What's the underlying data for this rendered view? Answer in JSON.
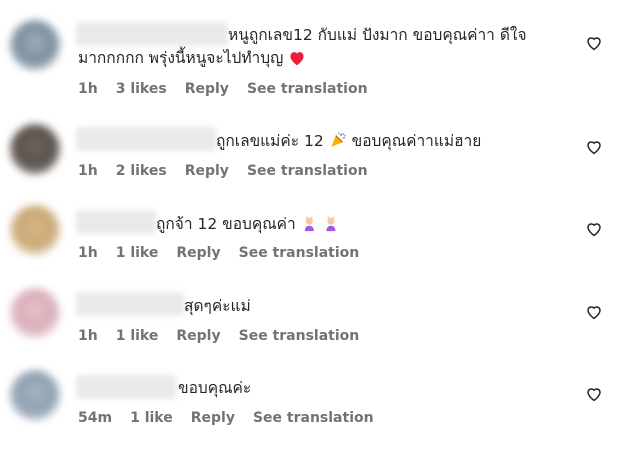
{
  "colors": {
    "text": "#262626",
    "meta": "#737373",
    "heart_red": "#ff3040"
  },
  "comments": [
    {
      "line1": "หนูถูกเลข12 กับแม่ ปังมาก ขอบคุณค่าา ดีใจ",
      "line2": "มากกกกก พรุ่งนี้หนูจะไปทำบุญ",
      "emoji": "red-heart",
      "time": "1h",
      "likes": "3 likes",
      "reply": "Reply",
      "translation": "See translation"
    },
    {
      "line1": "ถูกเลขแม่ค่ะ 12",
      "line1_suffix": "ขอบคุณค่าาแม่ฮาย",
      "emoji": "party-popper",
      "time": "1h",
      "likes": "2 likes",
      "reply": "Reply",
      "translation": "See translation"
    },
    {
      "line1": "ถูกจ้า 12 ขอบคุณค่า",
      "emoji": "people-with-bunny-ears",
      "time": "1h",
      "likes": "1 like",
      "reply": "Reply",
      "translation": "See translation"
    },
    {
      "line1": "สุดๆค่ะแม่",
      "time": "1h",
      "likes": "1 like",
      "reply": "Reply",
      "translation": "See translation"
    },
    {
      "line1": "ขอบคุณค่ะ",
      "time": "54m",
      "likes": "1 like",
      "reply": "Reply",
      "translation": "See translation"
    }
  ]
}
